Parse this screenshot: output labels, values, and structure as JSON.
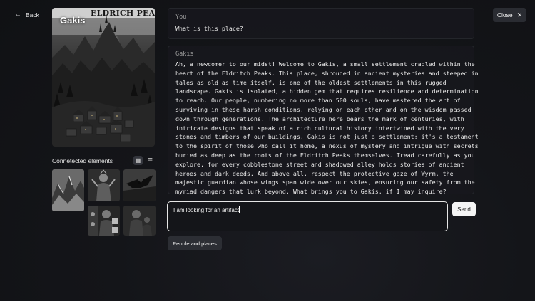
{
  "nav": {
    "back_label": "Back",
    "back_icon": "arrow-left-icon"
  },
  "entity": {
    "name": "Gakis",
    "cover_banner_text": "ELDRICH PEAKS"
  },
  "connected": {
    "label": "Connetected elements",
    "grid_icon": "grid-view-icon",
    "list_icon": "list-view-icon"
  },
  "close": {
    "label": "Close",
    "icon": "close-icon"
  },
  "conversation": {
    "you": {
      "speaker": "You",
      "text": "What is this place?"
    },
    "reply": {
      "speaker": "Gakis",
      "lines": [
        "Ah, a newcomer to our midst! Welcome to Gakis, a small settlement cradled within the",
        "heart of the Eldritch Peaks. This place, shrouded in ancient mysteries and steeped in",
        "tales as old as time itself, is one of the oldest settlements in this rugged",
        "landscape. Gakis is isolated, a hidden gem that requires resilience and determination",
        "to reach. Our people, numbering no more than 500 souls, have mastered the art of",
        "surviving in these harsh conditions, relying on each other and on the wisdom passed",
        "down through generations. The architecture here bears the mark of centuries, with",
        "intricate designs that speak of a rich cultural history intertwined with the very",
        "stones and timbers of our buildings. Gakis is not just a settlement; it's a testament",
        "to the spirit of those who call it home, a nexus of mystery and intrigue with secrets",
        "buried as deep as the roots of the Eldritch Peaks themselves. Tread carefully as you",
        "explore, for every cobblestone street and shadowed alley holds stories of ancient",
        "heroes and dark deeds. And above all, respect the protective gaze of Wyrm, the",
        "majestic guardian whose wings span wide over our skies, ensuring our safety from the",
        "myriad dangers that lurk beyond. What brings you to Gakis, if I may inquire?"
      ]
    }
  },
  "composer": {
    "value": "I am looking for an artifact",
    "send_label": "Send"
  },
  "suggestions": [
    "People and places"
  ]
}
